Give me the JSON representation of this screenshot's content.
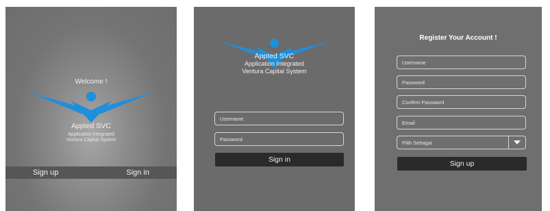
{
  "welcome_screen": {
    "welcome_text": "Welcome !",
    "brand_name": "Appted SVC",
    "tagline_line1": "Application Integrated",
    "tagline_line2": "Ventura Capital System",
    "signup_label": "Sign up",
    "signin_label": "Sign in"
  },
  "login_screen": {
    "brand_name": "Appted SVC",
    "tagline_line1": "Application Integrated",
    "tagline_line2": "Ventura Capital System",
    "username_placeholder": "Username",
    "password_placeholder": "Password",
    "signin_label": "Sign in"
  },
  "register_screen": {
    "title": "Register Your Account !",
    "username_placeholder": "Username",
    "password_placeholder": "Password",
    "confirm_password_placeholder": "Confirm Password",
    "email_placeholder": "Email",
    "role_select_value": "Pilih Sebagai",
    "signup_label": "Sign up"
  },
  "colors": {
    "logo_blue": "#1f8fdc",
    "screen_gray": "#6f6f6f",
    "button_dark": "#2a2a2a"
  },
  "icons": [
    "logo-icon",
    "chevron-down-icon"
  ]
}
